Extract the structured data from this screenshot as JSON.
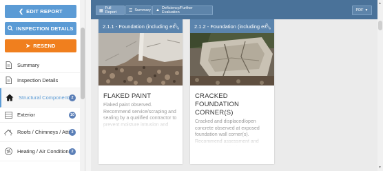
{
  "sidebar": {
    "buttons": {
      "edit_report": "EDIT REPORT",
      "inspection_details": "INSPECTION DETAILS",
      "resend": "RESEND"
    },
    "items": [
      {
        "label": "Summary",
        "icon": "document-icon",
        "count": ""
      },
      {
        "label": "Inspection Details",
        "icon": "document-icon",
        "count": ""
      },
      {
        "label": "Structural Components",
        "icon": "house-icon",
        "count": "2"
      },
      {
        "label": "Exterior",
        "icon": "siding-icon",
        "count": "10"
      },
      {
        "label": "Roofs / Chimneys / Attic",
        "icon": "roof-icon",
        "count": "3"
      },
      {
        "label": "Heating / Air Conditioning",
        "icon": "fan-icon",
        "count": "2"
      }
    ]
  },
  "toolbar": {
    "full_report": "Full Report",
    "summary": "Summary",
    "deficiency": "Deficiency/Further Evaluation",
    "pdf": "PDF"
  },
  "cards": [
    {
      "header": "2.1.1 - Foundation (including ex",
      "title": "FLAKED PAINT",
      "description": "Flaked paint observed. Recommend service/scraping and sealing by a qualified contractor to prevent moisture intrusion and further damage."
    },
    {
      "header": "2.1.2 - Foundation (including ex",
      "title": "CRACKED FOUNDATION CORNER(S)",
      "description": "Cracked and displaced/open concrete observed at exposed foundation wall corner(s). Recommend assessment and repair by a qualified contractor."
    }
  ],
  "colors": {
    "accent_blue": "#5b9bd5",
    "resend_orange": "#f07f1e",
    "toolbar_bg": "#4a7299",
    "card_header": "#5b84ad",
    "badge": "#5b7fb7"
  }
}
